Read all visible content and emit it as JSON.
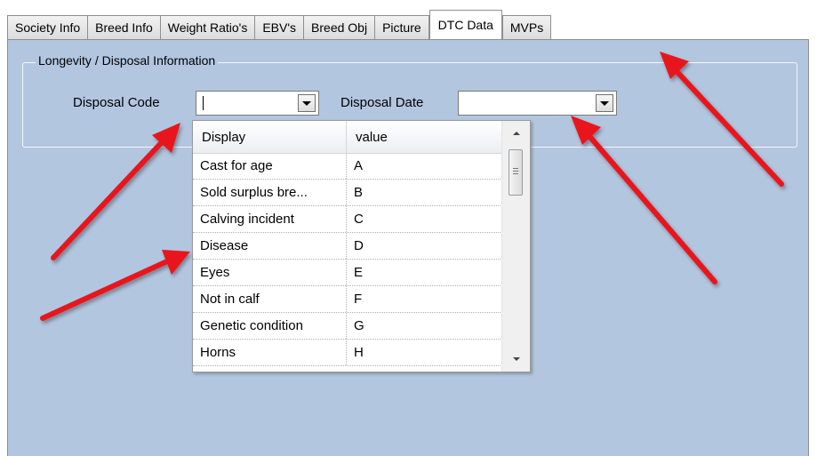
{
  "tabs": [
    {
      "label": "Society Info",
      "active": false
    },
    {
      "label": "Breed Info",
      "active": false
    },
    {
      "label": "Weight Ratio's",
      "active": false
    },
    {
      "label": "EBV's",
      "active": false
    },
    {
      "label": "Breed Obj",
      "active": false
    },
    {
      "label": "Picture",
      "active": false
    },
    {
      "label": "DTC Data",
      "active": true
    },
    {
      "label": "MVPs",
      "active": false
    }
  ],
  "group": {
    "title": "Longevity / Disposal Information",
    "disposal_code_label": "Disposal Code",
    "disposal_code_value": "",
    "disposal_date_label": "Disposal Date",
    "disposal_date_value": ""
  },
  "dropdown": {
    "columns": [
      "Display",
      "value"
    ],
    "rows": [
      {
        "display": "Cast for age",
        "value": "A"
      },
      {
        "display": "Sold surplus bre...",
        "value": "B"
      },
      {
        "display": "Calving incident",
        "value": "C"
      },
      {
        "display": "Disease",
        "value": "D"
      },
      {
        "display": "Eyes",
        "value": "E"
      },
      {
        "display": "Not in calf",
        "value": "F"
      },
      {
        "display": "Genetic condition",
        "value": "G"
      },
      {
        "display": "Horns",
        "value": "H"
      }
    ]
  },
  "colors": {
    "panel_bg": "#b3c6e0",
    "annotation_arrow": "#e8141b"
  },
  "icons": [
    "dropdown-arrow-icon",
    "scroll-up-icon",
    "scroll-down-icon",
    "annotation-arrow"
  ]
}
